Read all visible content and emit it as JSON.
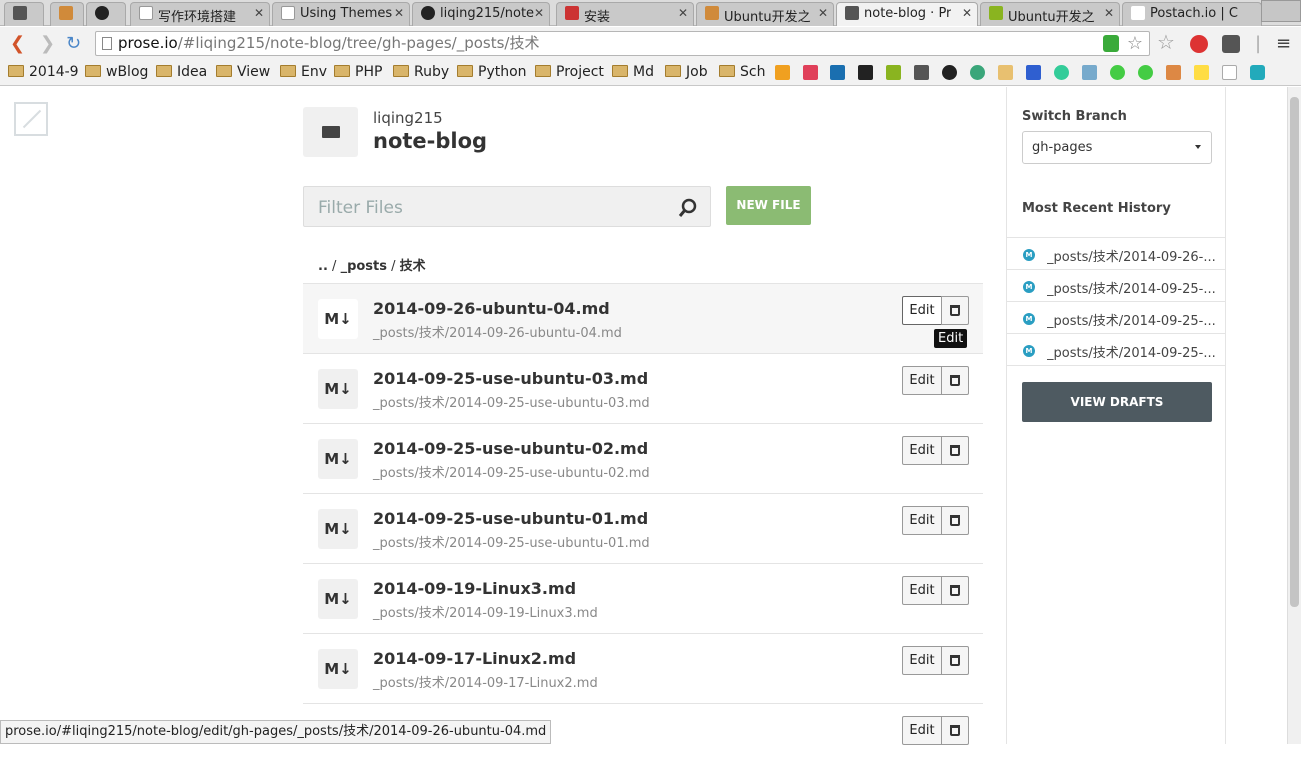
{
  "tabs": [
    {
      "label": "",
      "color": "#555"
    },
    {
      "label": "",
      "color": "#d08a3a"
    },
    {
      "label": "",
      "color": "#222"
    },
    {
      "label": "写作环境搭建",
      "color": "#888"
    },
    {
      "label": "Using Themes",
      "color": "#888"
    },
    {
      "label": "liqing215/note",
      "color": "#222"
    },
    {
      "label": "安装",
      "color": "#c33"
    },
    {
      "label": "Ubuntu开发之",
      "color": "#d08a3a"
    },
    {
      "label": "note-blog · Pr",
      "color": "#555"
    },
    {
      "label": "Ubuntu开发之",
      "color": "#8ab420"
    },
    {
      "label": "Postach.io | C",
      "color": "#c33"
    }
  ],
  "address": {
    "host": "prose.io",
    "path": "/#liqing215/note-blog/tree/gh-pages/_posts/技术"
  },
  "bookmarks": [
    "2014-9",
    "wBlog",
    "Idea",
    "View",
    "Env",
    "PHP",
    "Ruby",
    "Python",
    "Project",
    "Md",
    "Job",
    "Sch"
  ],
  "repo": {
    "owner": "liqing215",
    "name": "note-blog"
  },
  "filter_placeholder": "Filter Files",
  "new_file_label": "NEW FILE",
  "breadcrumb": {
    "up": "..",
    "sep1": "/",
    "dir": "_posts",
    "sep2": "/",
    "current": "技术"
  },
  "files": [
    {
      "name": "2014-09-26-ubuntu-04.md",
      "path": "_posts/技术/2014-09-26-ubuntu-04.md"
    },
    {
      "name": "2014-09-25-use-ubuntu-03.md",
      "path": "_posts/技术/2014-09-25-use-ubuntu-03.md"
    },
    {
      "name": "2014-09-25-use-ubuntu-02.md",
      "path": "_posts/技术/2014-09-25-use-ubuntu-02.md"
    },
    {
      "name": "2014-09-25-use-ubuntu-01.md",
      "path": "_posts/技术/2014-09-25-use-ubuntu-01.md"
    },
    {
      "name": "2014-09-19-Linux3.md",
      "path": "_posts/技术/2014-09-19-Linux3.md"
    },
    {
      "name": "2014-09-17-Linux2.md",
      "path": "_posts/技术/2014-09-17-Linux2.md"
    },
    {
      "name": "",
      "path": ""
    }
  ],
  "md_icon_label": "M↓",
  "edit_label": "Edit",
  "tooltip": "Edit",
  "sidebar": {
    "switch_branch": "Switch Branch",
    "branch": "gh-pages",
    "recent_history": "Most Recent History",
    "history": [
      "_posts/技术/2014-09-26-...",
      "_posts/技术/2014-09-25-...",
      "_posts/技术/2014-09-25-...",
      "_posts/技术/2014-09-25-..."
    ],
    "history_icon": "M",
    "view_drafts": "VIEW DRAFTS"
  },
  "status_url": "prose.io/#liqing215/note-blog/edit/gh-pages/_posts/技术/2014-09-26-ubuntu-04.md",
  "colors": {
    "accent_green": "#8bbb73",
    "drafts_bg": "#4e5a61",
    "history_icon": "#2a9ec2"
  }
}
